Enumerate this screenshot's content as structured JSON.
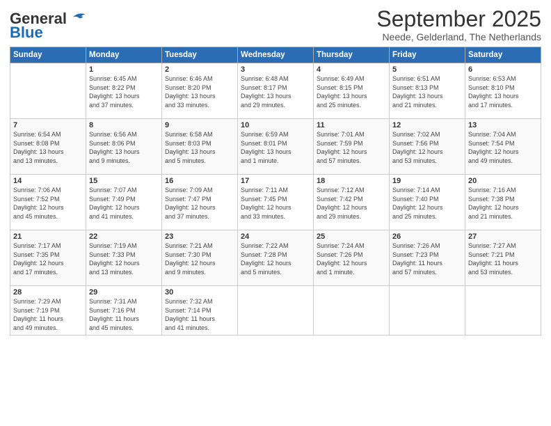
{
  "header": {
    "logo_general": "General",
    "logo_blue": "Blue",
    "month_title": "September 2025",
    "subtitle": "Neede, Gelderland, The Netherlands"
  },
  "days_of_week": [
    "Sunday",
    "Monday",
    "Tuesday",
    "Wednesday",
    "Thursday",
    "Friday",
    "Saturday"
  ],
  "weeks": [
    [
      {
        "day": "",
        "info": ""
      },
      {
        "day": "1",
        "info": "Sunrise: 6:45 AM\nSunset: 8:22 PM\nDaylight: 13 hours\nand 37 minutes."
      },
      {
        "day": "2",
        "info": "Sunrise: 6:46 AM\nSunset: 8:20 PM\nDaylight: 13 hours\nand 33 minutes."
      },
      {
        "day": "3",
        "info": "Sunrise: 6:48 AM\nSunset: 8:17 PM\nDaylight: 13 hours\nand 29 minutes."
      },
      {
        "day": "4",
        "info": "Sunrise: 6:49 AM\nSunset: 8:15 PM\nDaylight: 13 hours\nand 25 minutes."
      },
      {
        "day": "5",
        "info": "Sunrise: 6:51 AM\nSunset: 8:13 PM\nDaylight: 13 hours\nand 21 minutes."
      },
      {
        "day": "6",
        "info": "Sunrise: 6:53 AM\nSunset: 8:10 PM\nDaylight: 13 hours\nand 17 minutes."
      }
    ],
    [
      {
        "day": "7",
        "info": "Sunrise: 6:54 AM\nSunset: 8:08 PM\nDaylight: 13 hours\nand 13 minutes."
      },
      {
        "day": "8",
        "info": "Sunrise: 6:56 AM\nSunset: 8:06 PM\nDaylight: 13 hours\nand 9 minutes."
      },
      {
        "day": "9",
        "info": "Sunrise: 6:58 AM\nSunset: 8:03 PM\nDaylight: 13 hours\nand 5 minutes."
      },
      {
        "day": "10",
        "info": "Sunrise: 6:59 AM\nSunset: 8:01 PM\nDaylight: 13 hours\nand 1 minute."
      },
      {
        "day": "11",
        "info": "Sunrise: 7:01 AM\nSunset: 7:59 PM\nDaylight: 12 hours\nand 57 minutes."
      },
      {
        "day": "12",
        "info": "Sunrise: 7:02 AM\nSunset: 7:56 PM\nDaylight: 12 hours\nand 53 minutes."
      },
      {
        "day": "13",
        "info": "Sunrise: 7:04 AM\nSunset: 7:54 PM\nDaylight: 12 hours\nand 49 minutes."
      }
    ],
    [
      {
        "day": "14",
        "info": "Sunrise: 7:06 AM\nSunset: 7:52 PM\nDaylight: 12 hours\nand 45 minutes."
      },
      {
        "day": "15",
        "info": "Sunrise: 7:07 AM\nSunset: 7:49 PM\nDaylight: 12 hours\nand 41 minutes."
      },
      {
        "day": "16",
        "info": "Sunrise: 7:09 AM\nSunset: 7:47 PM\nDaylight: 12 hours\nand 37 minutes."
      },
      {
        "day": "17",
        "info": "Sunrise: 7:11 AM\nSunset: 7:45 PM\nDaylight: 12 hours\nand 33 minutes."
      },
      {
        "day": "18",
        "info": "Sunrise: 7:12 AM\nSunset: 7:42 PM\nDaylight: 12 hours\nand 29 minutes."
      },
      {
        "day": "19",
        "info": "Sunrise: 7:14 AM\nSunset: 7:40 PM\nDaylight: 12 hours\nand 25 minutes."
      },
      {
        "day": "20",
        "info": "Sunrise: 7:16 AM\nSunset: 7:38 PM\nDaylight: 12 hours\nand 21 minutes."
      }
    ],
    [
      {
        "day": "21",
        "info": "Sunrise: 7:17 AM\nSunset: 7:35 PM\nDaylight: 12 hours\nand 17 minutes."
      },
      {
        "day": "22",
        "info": "Sunrise: 7:19 AM\nSunset: 7:33 PM\nDaylight: 12 hours\nand 13 minutes."
      },
      {
        "day": "23",
        "info": "Sunrise: 7:21 AM\nSunset: 7:30 PM\nDaylight: 12 hours\nand 9 minutes."
      },
      {
        "day": "24",
        "info": "Sunrise: 7:22 AM\nSunset: 7:28 PM\nDaylight: 12 hours\nand 5 minutes."
      },
      {
        "day": "25",
        "info": "Sunrise: 7:24 AM\nSunset: 7:26 PM\nDaylight: 12 hours\nand 1 minute."
      },
      {
        "day": "26",
        "info": "Sunrise: 7:26 AM\nSunset: 7:23 PM\nDaylight: 11 hours\nand 57 minutes."
      },
      {
        "day": "27",
        "info": "Sunrise: 7:27 AM\nSunset: 7:21 PM\nDaylight: 11 hours\nand 53 minutes."
      }
    ],
    [
      {
        "day": "28",
        "info": "Sunrise: 7:29 AM\nSunset: 7:19 PM\nDaylight: 11 hours\nand 49 minutes."
      },
      {
        "day": "29",
        "info": "Sunrise: 7:31 AM\nSunset: 7:16 PM\nDaylight: 11 hours\nand 45 minutes."
      },
      {
        "day": "30",
        "info": "Sunrise: 7:32 AM\nSunset: 7:14 PM\nDaylight: 11 hours\nand 41 minutes."
      },
      {
        "day": "",
        "info": ""
      },
      {
        "day": "",
        "info": ""
      },
      {
        "day": "",
        "info": ""
      },
      {
        "day": "",
        "info": ""
      }
    ]
  ]
}
